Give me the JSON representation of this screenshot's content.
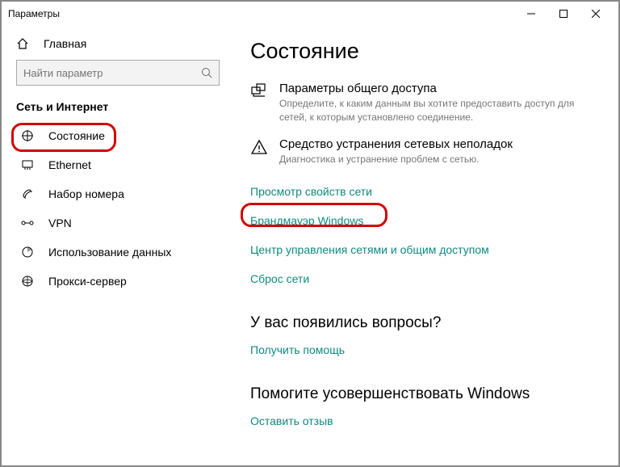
{
  "window": {
    "title": "Параметры"
  },
  "home": {
    "label": "Главная"
  },
  "search": {
    "placeholder": "Найти параметр"
  },
  "section": {
    "title": "Сеть и Интернет"
  },
  "nav": {
    "items": [
      {
        "label": "Состояние"
      },
      {
        "label": "Ethernet"
      },
      {
        "label": "Набор номера"
      },
      {
        "label": "VPN"
      },
      {
        "label": "Использование данных"
      },
      {
        "label": "Прокси-сервер"
      }
    ]
  },
  "page": {
    "title": "Состояние"
  },
  "settings": {
    "sharing": {
      "title": "Параметры общего доступа",
      "desc": "Определите, к каким данным вы хотите предоставить доступ для сетей, к которым установлено соединение."
    },
    "trouble": {
      "title": "Средство устранения сетевых неполадок",
      "desc": "Диагностика и устранение проблем с сетью."
    }
  },
  "links": {
    "view_props": "Просмотр свойств сети",
    "firewall": "Брандмауэр Windows",
    "center": "Центр управления сетями и общим доступом",
    "reset": "Сброс сети"
  },
  "help": {
    "heading": "У вас появились вопросы?",
    "link": "Получить помощь"
  },
  "feedback": {
    "heading": "Помогите усовершенствовать Windows",
    "link": "Оставить отзыв"
  }
}
